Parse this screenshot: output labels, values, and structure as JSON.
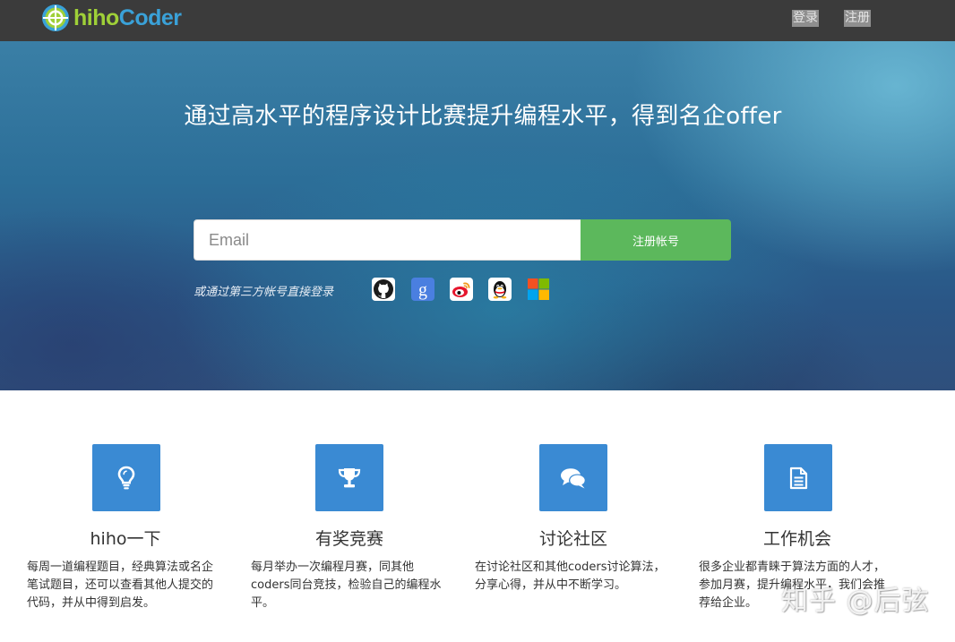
{
  "brand": {
    "logo_icon": "target-icon",
    "name_part1": "hiho",
    "name_part2": "Coder",
    "colors": {
      "hiho": "#9fd038",
      "coder": "#3aa1d8"
    }
  },
  "nav": {
    "login_label": "登录",
    "register_label": "注册"
  },
  "hero": {
    "headline": "通过高水平的程序设计比赛提升编程水平，得到名企offer",
    "email_placeholder": "Email",
    "signup_button": "注册帐号",
    "signup_button_color": "#5cb85c",
    "third_party_label": "或通过第三方帐号直接登录",
    "social_logins": [
      {
        "icon": "github-icon"
      },
      {
        "icon": "google-icon"
      },
      {
        "icon": "weibo-icon"
      },
      {
        "icon": "qq-icon"
      },
      {
        "icon": "microsoft-icon"
      }
    ]
  },
  "features": [
    {
      "icon": "lightbulb-icon",
      "title": "hiho一下",
      "description": "每周一道编程题目，经典算法或名企笔试题目，还可以查看其他人提交的代码，并从中得到启发。"
    },
    {
      "icon": "trophy-icon",
      "title": "有奖竞赛",
      "description": "每月举办一次编程月赛，同其他coders同台竞技，检验自己的编程水平。"
    },
    {
      "icon": "comments-icon",
      "title": "讨论社区",
      "description": "在讨论社区和其他coders讨论算法，分享心得，并从中不断学习。"
    },
    {
      "icon": "document-icon",
      "title": "工作机会",
      "description": "很多企业都青睐于算法方面的人才，参加月赛，提升编程水平，我们会推荐给企业。"
    }
  ],
  "feature_icon_color": "#3a8ad3",
  "watermark": "知乎 @后弦"
}
